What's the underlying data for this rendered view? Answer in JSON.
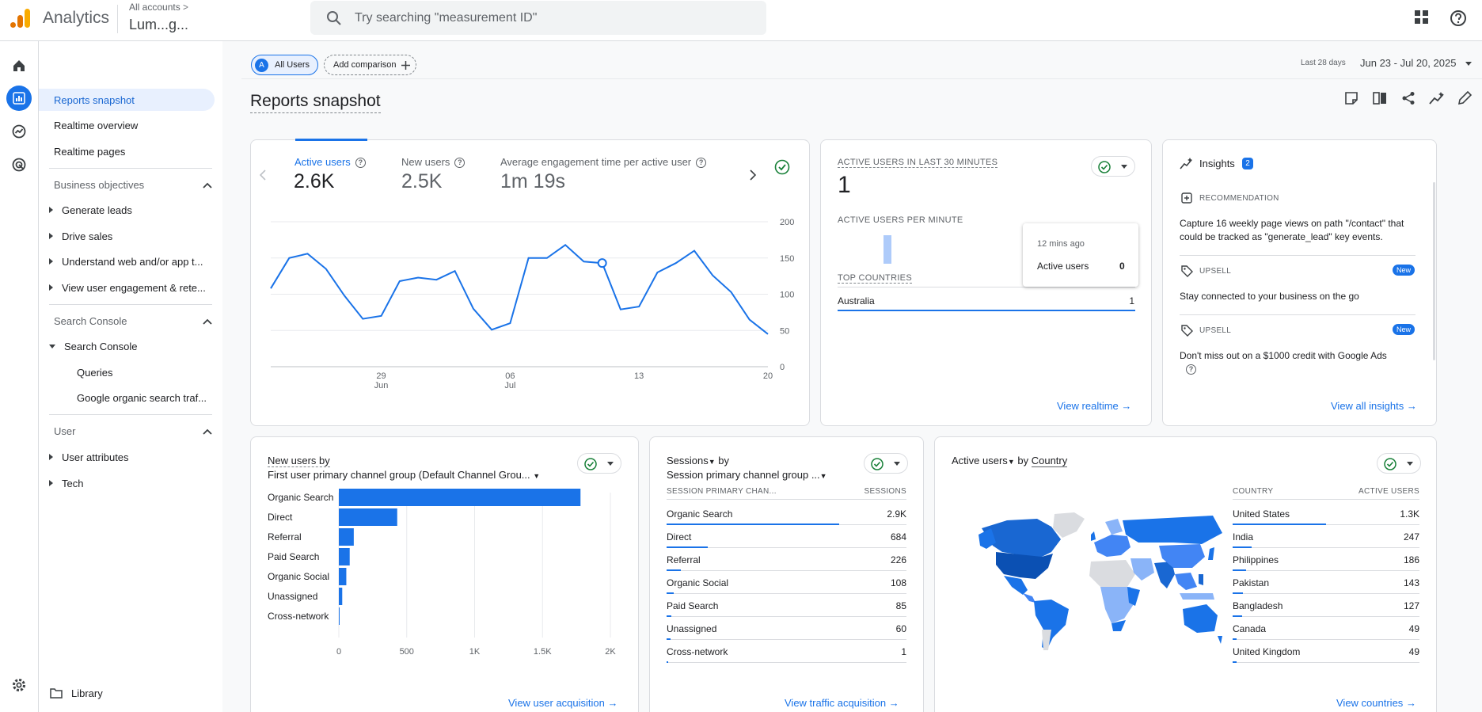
{
  "topbar": {
    "app_name": "Analytics",
    "breadcrumb": "All accounts >",
    "account_name": "Lum...g...",
    "search_placeholder": "Try searching \"measurement ID\""
  },
  "nav": {
    "reports_snapshot": "Reports snapshot",
    "realtime_overview": "Realtime overview",
    "realtime_pages": "Realtime pages",
    "business_objectives": "Business objectives",
    "generate_leads": "Generate leads",
    "drive_sales": "Drive sales",
    "understand_web": "Understand web and/or app t...",
    "view_engagement": "View user engagement & rete...",
    "search_console_section": "Search Console",
    "search_console": "Search Console",
    "queries": "Queries",
    "google_organic": "Google organic search traf...",
    "user_section": "User",
    "user_attributes": "User attributes",
    "tech": "Tech",
    "library": "Library"
  },
  "toolbar": {
    "all_users_avatar": "A",
    "all_users": "All Users",
    "add_comparison": "Add comparison",
    "date_label": "Last 28 days",
    "date_range": "Jun 23 - Jul 20, 2025",
    "page_title": "Reports snapshot"
  },
  "overview": {
    "active_users_label": "Active users",
    "active_users_value": "2.6K",
    "new_users_label": "New users",
    "new_users_value": "2.5K",
    "engagement_label": "Average engagement time per active user",
    "engagement_value": "1m 19s",
    "x_ticks": [
      {
        "day": "29",
        "month": "Jun"
      },
      {
        "day": "06",
        "month": "Jul"
      },
      {
        "day": "13",
        "month": ""
      },
      {
        "day": "20",
        "month": ""
      }
    ],
    "y_ticks": [
      "200",
      "150",
      "100",
      "50",
      "0"
    ]
  },
  "chart_data": {
    "type": "line",
    "title": "",
    "series": [
      {
        "name": "Active users",
        "values": [
          108,
          150,
          156,
          135,
          98,
          66,
          70,
          118,
          123,
          120,
          132,
          80,
          51,
          60,
          150,
          150,
          168,
          145,
          143,
          79,
          83,
          130,
          143,
          160,
          126,
          103,
          65,
          45
        ]
      }
    ],
    "ylim": [
      0,
      200
    ],
    "x_first": "Jun 23",
    "x_last": "Jul 20"
  },
  "realtime": {
    "title": "ACTIVE USERS IN LAST 30 MINUTES",
    "value": "1",
    "per_minute": "ACTIVE USERS PER MINUTE",
    "tooltip_time": "12 mins ago",
    "tooltip_label": "Active users",
    "tooltip_value": "0",
    "top_countries": "TOP COUNTRIES",
    "country": "Australia",
    "country_value": "1",
    "view_link": "View realtime"
  },
  "insights": {
    "title": "Insights",
    "count": "2",
    "rec_label": "RECOMMENDATION",
    "rec_text": "Capture 16 weekly page views on path \"/contact\" that could be tracked as \"generate_lead\" key events.",
    "upsell_label": "UPSELL",
    "new_badge": "New",
    "upsell1_text": "Stay connected to your business on the go",
    "upsell2_text": "Don't miss out on a $1000 credit with Google Ads",
    "view_link": "View all insights"
  },
  "new_users_card": {
    "title": "New users by",
    "subtitle": "First user primary channel group (Default Channel Grou...",
    "categories": [
      "Organic Search",
      "Direct",
      "Referral",
      "Paid Search",
      "Organic Social",
      "Unassigned",
      "Cross-network"
    ],
    "values": [
      1780,
      430,
      110,
      80,
      55,
      25,
      5
    ],
    "x_ticks": [
      "0",
      "500",
      "1K",
      "1.5K",
      "2K"
    ],
    "xmax": 2000,
    "view_link": "View user acquisition"
  },
  "sessions_card": {
    "title_metric": "Sessions",
    "title_by": "by",
    "subtitle": "Session primary channel group ...",
    "col1": "SESSION PRIMARY CHAN...",
    "col2": "SESSIONS",
    "rows": [
      {
        "label": "Organic Search",
        "value": "2.9K",
        "frac": 0.72
      },
      {
        "label": "Direct",
        "value": "684",
        "frac": 0.17
      },
      {
        "label": "Referral",
        "value": "226",
        "frac": 0.06
      },
      {
        "label": "Organic Social",
        "value": "108",
        "frac": 0.03
      },
      {
        "label": "Paid Search",
        "value": "85",
        "frac": 0.02
      },
      {
        "label": "Unassigned",
        "value": "60",
        "frac": 0.015
      },
      {
        "label": "Cross-network",
        "value": "1",
        "frac": 0.003
      }
    ],
    "view_link": "View traffic acquisition"
  },
  "country_card": {
    "title_metric": "Active users",
    "title_by": "by",
    "title_dim": "Country",
    "col1": "COUNTRY",
    "col2": "ACTIVE USERS",
    "rows": [
      {
        "label": "United States",
        "value": "1.3K",
        "frac": 0.5
      },
      {
        "label": "India",
        "value": "247",
        "frac": 0.1
      },
      {
        "label": "Philippines",
        "value": "186",
        "frac": 0.07
      },
      {
        "label": "Pakistan",
        "value": "143",
        "frac": 0.055
      },
      {
        "label": "Bangladesh",
        "value": "127",
        "frac": 0.05
      },
      {
        "label": "Canada",
        "value": "49",
        "frac": 0.02
      },
      {
        "label": "United Kingdom",
        "value": "49",
        "frac": 0.02
      }
    ],
    "view_link": "View countries"
  },
  "colors": {
    "accent": "#1a73e8",
    "success": "#188038"
  }
}
